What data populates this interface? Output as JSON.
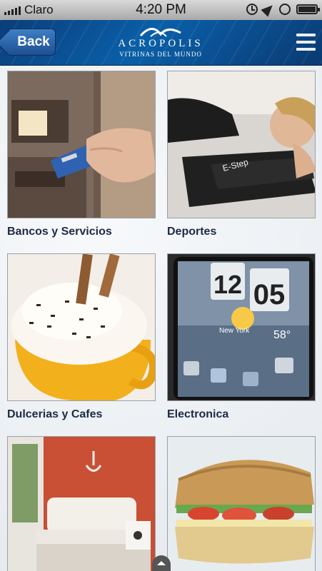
{
  "status_bar": {
    "carrier": "Claro",
    "time": "4:20 PM"
  },
  "header": {
    "back_label": "Back",
    "logo_name": "ACROPOLIS",
    "logo_tagline": "VITRINAS DEL MUNDO"
  },
  "categories": [
    {
      "label": "Bancos y Servicios"
    },
    {
      "label": "Deportes"
    },
    {
      "label": "Dulcerias y Cafes"
    },
    {
      "label": "Electronica"
    },
    {
      "label": ""
    },
    {
      "label": ""
    }
  ],
  "phone_widget": {
    "hour": "12",
    "minute": "05",
    "city": "New York",
    "temp": "58°"
  },
  "colors": {
    "header_blue": "#0a4f92",
    "label_text": "#1c2a44"
  }
}
